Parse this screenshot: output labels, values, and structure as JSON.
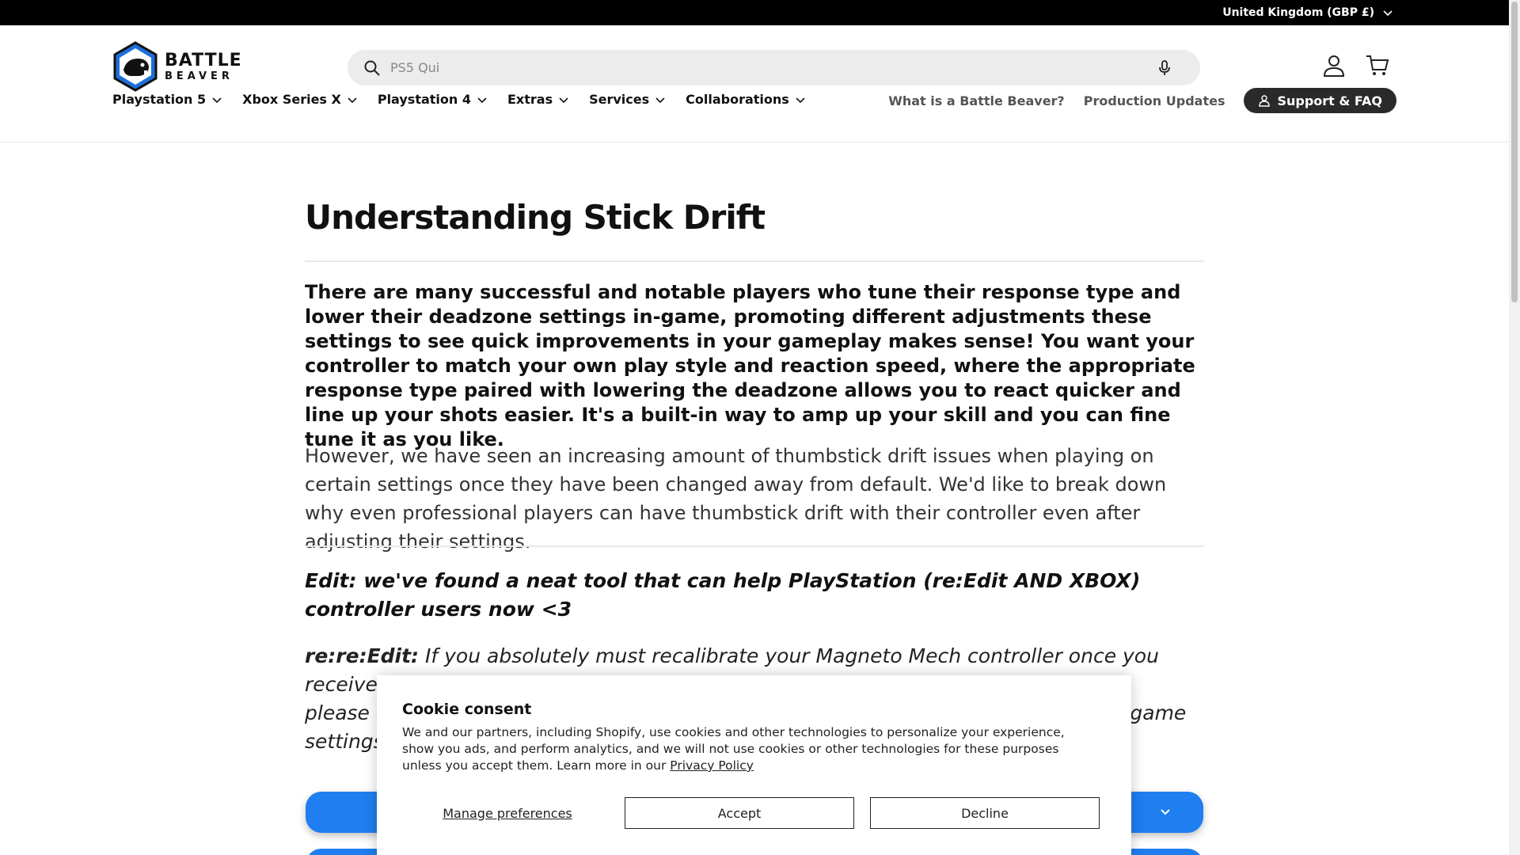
{
  "topbar": {
    "country": "United Kingdom (GBP £)"
  },
  "brand": {
    "line1": "BATTLE",
    "line2": "BEAVER"
  },
  "search": {
    "value": "PS5 Qui"
  },
  "nav": {
    "items": [
      {
        "label": "Playstation 5"
      },
      {
        "label": "Xbox Series X"
      },
      {
        "label": "Playstation 4"
      },
      {
        "label": "Extras"
      },
      {
        "label": "Services"
      },
      {
        "label": "Collaborations"
      }
    ],
    "links": [
      {
        "label": "What is a Battle Beaver?"
      },
      {
        "label": "Production Updates"
      }
    ],
    "support": "Support & FAQ"
  },
  "article": {
    "title": "Understanding Stick Drift",
    "lead": "There are many successful and notable players who tune their response type and lower their deadzone settings in-game, promoting different adjustments these settings to see quick improvements in your gameplay makes sense! You want your controller to match your own play style and reaction speed, where the appropriate response type paired with lowering the deadzone allows you to react quicker and line up your shots easier. It's a built-in way to amp up your skill and you can fine tune it as you like.",
    "para": "However, we have seen an increasing amount of thumbstick drift issues when playing on certain settings once they have been changed away from default. We'd like to break down why even professional players can have thumbstick drift with their controller even after adjusting their settings.",
    "edit1": "Edit: we've found a neat tool that can help PlayStation (re:Edit AND XBOX) controller users now <3",
    "edit2_label": "re:re:Edit:",
    "edit2_line1": " If you absolutely must recalibrate your Magneto Mech controller once you receive it,",
    "edit2_line2_start": "please k",
    "edit2_line2_end": "-game",
    "edit2_line3": "settings"
  },
  "cookie": {
    "title": "Cookie consent",
    "body": "We and our partners, including Shopify, use cookies and other technologies to personalize your experience, show you ads, and perform analytics, and we will not use cookies or other technologies for these purposes unless you accept them. Learn more in our ",
    "privacy": "Privacy Policy",
    "manage": "Manage preferences",
    "accept": "Accept",
    "decline": "Decline"
  },
  "colors": {
    "accent_blue": "#1f7ef0",
    "topbar": "#000000",
    "logo_blue": "#1e6fd9"
  },
  "icons": [
    "chevron-down-icon",
    "search-icon",
    "microphone-icon",
    "account-icon",
    "cart-icon",
    "user-icon"
  ]
}
